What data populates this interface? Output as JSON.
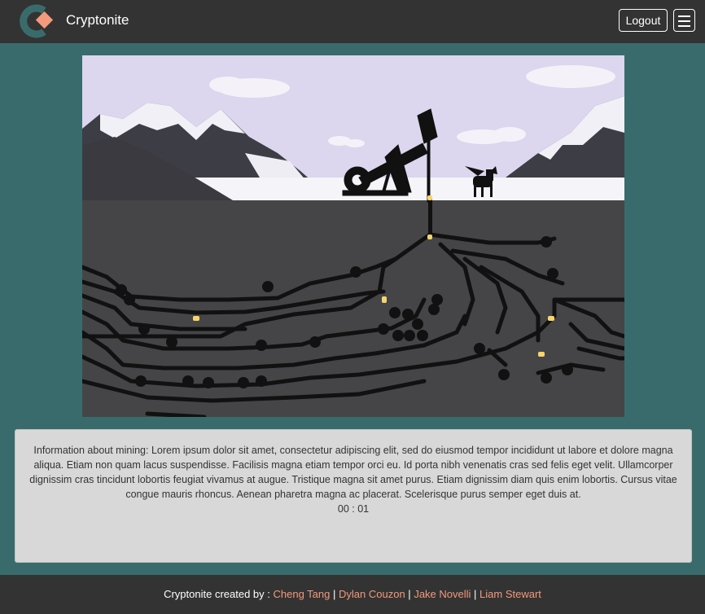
{
  "navbar": {
    "brand_name": "Cryptonite",
    "logout_label": "Logout"
  },
  "icons": {
    "brand_logo": "logo-icon",
    "menu": "hamburger-menu-icon"
  },
  "colors": {
    "navbar_bg": "#333333",
    "page_bg": "#3a6b6c",
    "logo_teal": "#3a6b6c",
    "logo_accent": "#f39a7c",
    "link_color": "#f39a7c",
    "panel_bg": "#d8d8d8"
  },
  "main": {
    "info_text": "Information about mining: Lorem ipsum dolor sit amet, consectetur adipiscing elit, sed do eiusmod tempor incididunt ut labore et dolore magna aliqua. Etiam non quam lacus suspendisse. Facilisis magna etiam tempor orci eu. Id porta nibh venenatis cras sed felis eget velit. Ullamcorper dignissim cras tincidunt lobortis feugiat vivamus at augue. Tristique magna sit amet purus. Etiam dignissim diam quis enim lobortis. Cursus vitae congue mauris rhoncus. Aenean pharetra magna ac placerat. Scelerisque purus semper eget duis at.",
    "timer": "00 : 01"
  },
  "footer": {
    "prefix": "Cryptonite created by :",
    "separator": "|",
    "authors": [
      "Cheng Tang",
      "Dylan Couzon",
      "Jake Novelli",
      "Liam Stewart"
    ]
  }
}
